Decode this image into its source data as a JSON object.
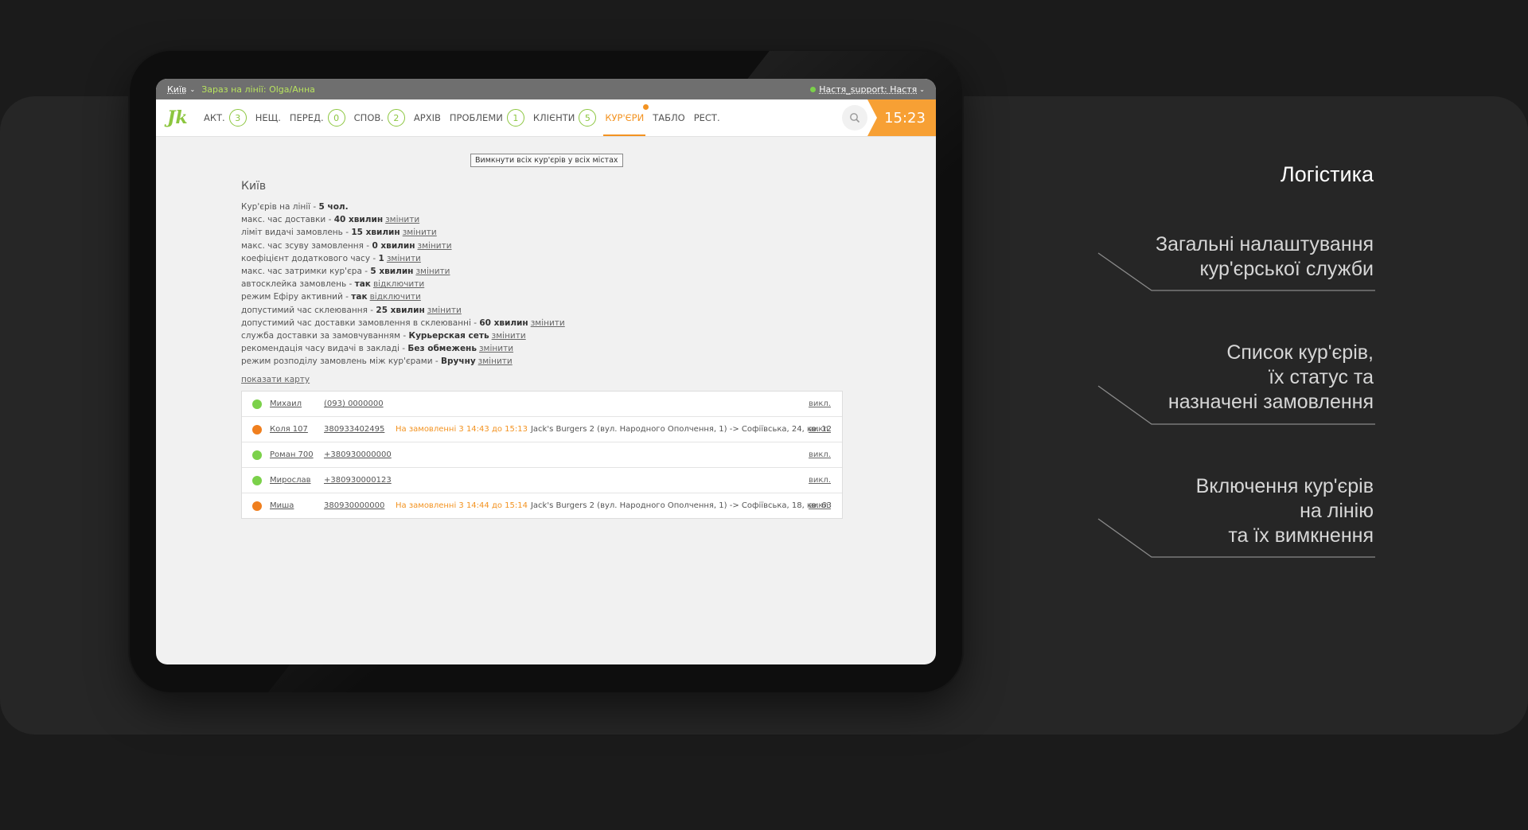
{
  "app": {
    "city": "Київ",
    "online_label": "Зараз на лінії: Olga/Анна",
    "user": "Настя_support: Настя",
    "clock": "15:23"
  },
  "nav": [
    {
      "label": "АКТ.",
      "count": "3"
    },
    {
      "label": "НЕЩ.",
      "count": null
    },
    {
      "label": "ПЕРЕД.",
      "count": "0"
    },
    {
      "label": "СПОВ.",
      "count": "2"
    },
    {
      "label": "АРХІВ",
      "count": null
    },
    {
      "label": "ПРОБЛЕМИ",
      "count": "1"
    },
    {
      "label": "КЛІЄНТИ",
      "count": "5"
    },
    {
      "label": "КУР'ЄРИ",
      "count": null,
      "active": true
    },
    {
      "label": "ТАБЛО",
      "count": null
    },
    {
      "label": "РЕСТ.",
      "count": null
    }
  ],
  "page": {
    "disable_all_button": "Вимкнути всіх кур'єрів у всіх містах",
    "city_title": "Київ",
    "show_map": "показати карту"
  },
  "settings": [
    {
      "label": "Кур'єрів на лінії - ",
      "value": "5 чол.",
      "action": ""
    },
    {
      "label": "макс. час доставки - ",
      "value": "40 хвилин",
      "action": "змінити"
    },
    {
      "label": "ліміт видачі замовлень - ",
      "value": "15 хвилин",
      "action": "змінити"
    },
    {
      "label": "макс. час зсуву замовлення - ",
      "value": "0 хвилин",
      "action": "змінити"
    },
    {
      "label": "коефіцієнт додаткового часу - ",
      "value": "1",
      "action": "змінити"
    },
    {
      "label": "макс. час затримки кур'єра - ",
      "value": "5 хвилин",
      "action": "змінити"
    },
    {
      "label": "автосклейка замовлень - ",
      "value": "так",
      "action": "відключити"
    },
    {
      "label": "режим Ефіру активний - ",
      "value": "так",
      "action": "відключити"
    },
    {
      "label": "допустимий час склеювання - ",
      "value": "25 хвилин",
      "action": "змінити"
    },
    {
      "label": "допустимий час доставки замовлення в склеюванні - ",
      "value": "60 хвилин",
      "action": "змінити"
    },
    {
      "label": "служба доставки за замовчуванням - ",
      "value": "Курьерская сеть",
      "action": "змінити"
    },
    {
      "label": "рекомендація часу видачі в закладі - ",
      "value": "Без обмежень",
      "action": "змінити"
    },
    {
      "label": "режим розподілу замовлень між кур'єрами - ",
      "value": "Вручну",
      "action": "змінити"
    }
  ],
  "couriers": [
    {
      "name": "Михаил",
      "phone": "(093) 0000000",
      "status_color": "#7bd14a",
      "order_time": "",
      "order_addr": "",
      "off": "викл."
    },
    {
      "name": "Коля 107",
      "phone": "380933402495",
      "status_color": "#f07f1e",
      "order_time": "На замовленні 3 14:43 до 15:13",
      "order_addr": "Jack's Burgers 2 (вул. Народного Ополчення, 1) -> Софіївська, 24, кв. 12",
      "off": "викл."
    },
    {
      "name": "Роман 700",
      "phone": "+380930000000",
      "status_color": "#7bd14a",
      "order_time": "",
      "order_addr": "",
      "off": "викл."
    },
    {
      "name": "Мирослав",
      "phone": "+380930000123",
      "status_color": "#7bd14a",
      "order_time": "",
      "order_addr": "",
      "off": "викл."
    },
    {
      "name": "Миша",
      "phone": "380930000000",
      "status_color": "#f07f1e",
      "order_time": "На замовленні 3 14:44 до 15:14",
      "order_addr": "Jack's Burgers 2 (вул. Народного Ополчення, 1) -> Софіївська, 18, кв. 63",
      "off": "викл."
    }
  ],
  "annotations": {
    "title": "Логістика",
    "items": [
      {
        "lines": [
          "Загальні налаштування",
          "кур'єрської служби"
        ]
      },
      {
        "lines": [
          "Список кур'єрів,",
          "їх статус та",
          "назначені замовлення"
        ]
      },
      {
        "lines": [
          "Включення кур'єрів",
          "на лінію",
          "та їх вимкнення"
        ]
      }
    ]
  },
  "colors": {
    "accent_green": "#8cc63f",
    "accent_orange": "#f39321"
  }
}
